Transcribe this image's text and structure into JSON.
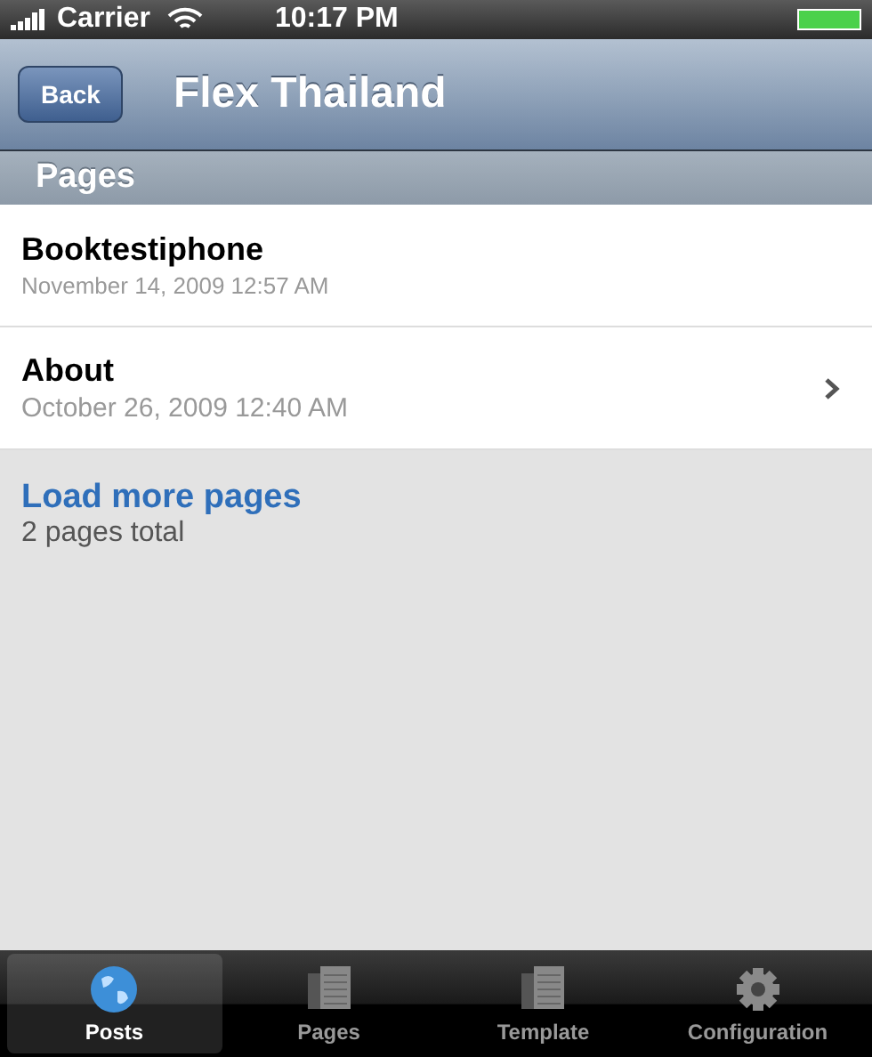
{
  "status_bar": {
    "carrier": "Carrier",
    "time": "10:17 PM"
  },
  "nav_bar": {
    "back_button": "Back",
    "title": "Flex Thailand"
  },
  "section_header": "Pages",
  "rows": [
    {
      "title": "Booktestiphone",
      "date": "November 14, 2009 12:57 AM",
      "chevron": false
    },
    {
      "title": "About",
      "date": "October 26, 2009 12:40 AM",
      "chevron": true
    }
  ],
  "load_more": {
    "label": "Load more pages",
    "count": "2 pages total"
  },
  "tab_bar": [
    {
      "label": "Posts",
      "kind": "globe",
      "selected": true
    },
    {
      "label": "Pages",
      "kind": "document",
      "selected": false
    },
    {
      "label": "Template",
      "kind": "document",
      "selected": false
    },
    {
      "label": "Configuration",
      "kind": "gear",
      "selected": false
    }
  ]
}
